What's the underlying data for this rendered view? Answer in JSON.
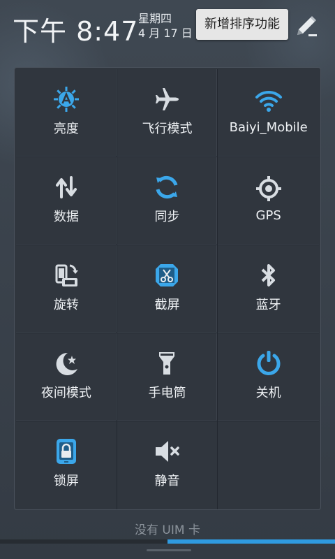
{
  "status_bar": {
    "time": "下午 8:47",
    "weekday": "星期四",
    "date": "4 月 17 日",
    "tooltip": "新增排序功能",
    "edit_icon": "pencil-edit-icon"
  },
  "tiles": [
    {
      "label": "亮度",
      "icon": "brightness-auto-icon"
    },
    {
      "label": "飞行模式",
      "icon": "airplane-icon"
    },
    {
      "label": "Baiyi_Mobile",
      "icon": "wifi-icon"
    },
    {
      "label": "数据",
      "icon": "data-arrows-icon"
    },
    {
      "label": "同步",
      "icon": "sync-icon"
    },
    {
      "label": "GPS",
      "icon": "gps-icon"
    },
    {
      "label": "旋转",
      "icon": "rotate-icon"
    },
    {
      "label": "截屏",
      "icon": "screenshot-icon"
    },
    {
      "label": "蓝牙",
      "icon": "bluetooth-icon"
    },
    {
      "label": "夜间模式",
      "icon": "night-mode-icon"
    },
    {
      "label": "手电筒",
      "icon": "flashlight-icon"
    },
    {
      "label": "关机",
      "icon": "power-icon"
    },
    {
      "label": "锁屏",
      "icon": "lock-screen-icon"
    },
    {
      "label": "静音",
      "icon": "mute-icon"
    }
  ],
  "footer": {
    "carrier_text": "没有 UIM 卡",
    "progress": 0.5
  },
  "colors": {
    "accent": "#2f9ae0",
    "icon_blue": "#3ba7ea",
    "icon_gray": "#d8dde2"
  }
}
